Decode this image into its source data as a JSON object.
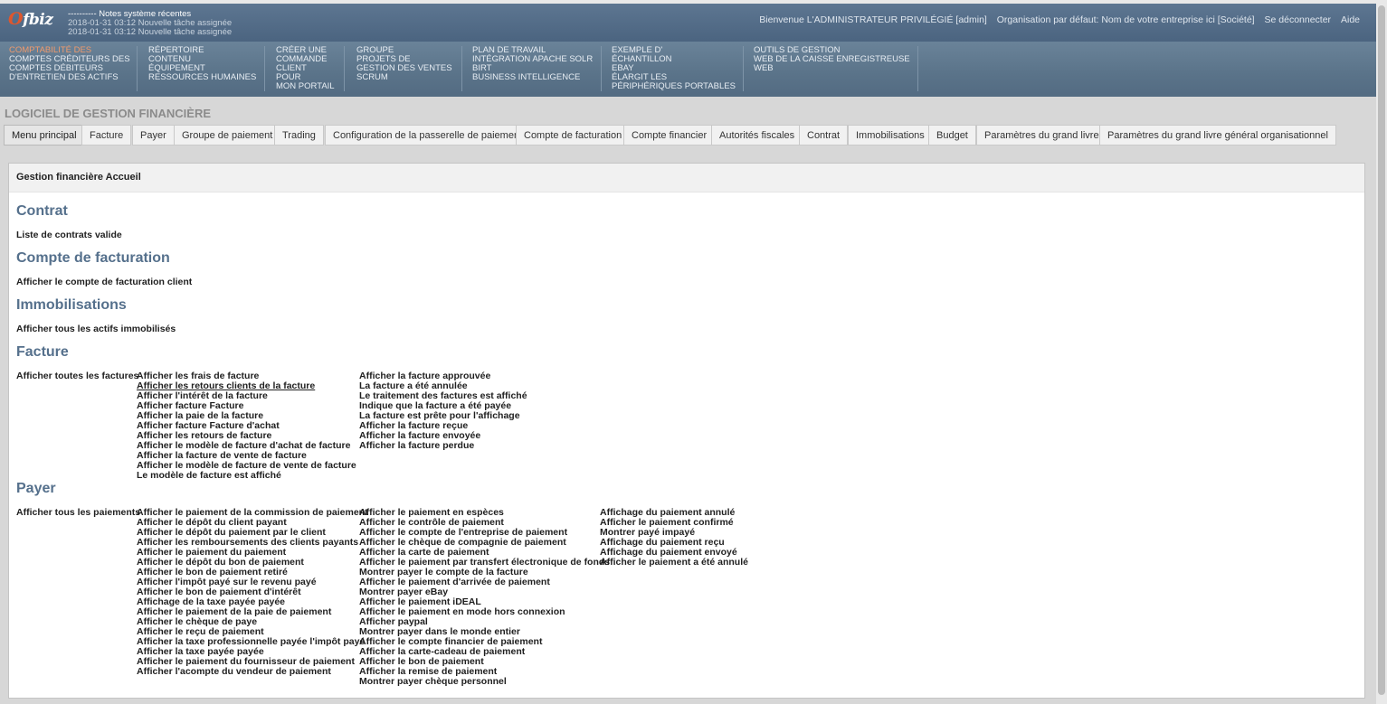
{
  "header": {
    "logo": "ofbiz",
    "notes_title": "---------- Notes système récentes",
    "notes": [
      "2018-01-31 03:12 Nouvelle tâche assignée",
      "2018-01-31 03:12 Nouvelle tâche assignée"
    ],
    "welcome": "Bienvenue L'ADMINISTRATEUR PRIVILÉGIÉ [admin]",
    "organisation": "Organisation par défaut: Nom de votre entreprise ici [Société]",
    "logout": "Se déconnecter",
    "help": "Aide"
  },
  "apps": [
    [
      "Comptabilité des",
      "comptes créditeurs des",
      "comptes débiteurs",
      "d'entretien des actifs"
    ],
    [
      "Répertoire",
      "Contenu",
      "Équipement",
      "Ressources humaines"
    ],
    [
      "Créer une",
      "commande",
      "client",
      "pour",
      "mon portail"
    ],
    [
      "Groupe",
      "projets de",
      "gestion des ventes",
      "Scrum"
    ],
    [
      "Plan de travail",
      "Intégration Apache SOLR",
      "BIRT",
      "Business Intelligence"
    ],
    [
      "Exemple d'",
      "échantillon",
      "eBay",
      "élargit les",
      "périphériques portables"
    ],
    [
      "Outils de gestion",
      "web de la caisse enregistreuse",
      "web"
    ]
  ],
  "app_title": "Logiciel de gestion financière",
  "tabs": [
    "Menu principal",
    "Facture",
    "Payer",
    "Groupe de paiement",
    "Trading",
    "Configuration de la passerelle de paiement",
    "Compte de facturation",
    "Compte financier",
    "Autorités fiscales",
    "Contrat",
    "Immobilisations",
    "Budget",
    "Paramètres du grand livre",
    "Paramètres du grand livre général organisationnel"
  ],
  "panel_title": "Gestion financière Accueil",
  "sections": {
    "contrat": {
      "title": "Contrat",
      "links": [
        "Liste de contrats valide"
      ]
    },
    "compte": {
      "title": "Compte de facturation",
      "links": [
        "Afficher le compte de facturation client"
      ]
    },
    "immo": {
      "title": "Immobilisations",
      "links": [
        "Afficher tous les actifs immobilisés"
      ]
    },
    "facture": {
      "title": "Facture",
      "col1": [
        "Afficher toutes les factures"
      ],
      "col2": [
        "Afficher les frais de facture",
        "Afficher les retours clients de la facture",
        "Afficher l'intérêt de la facture",
        "Afficher facture Facture",
        "Afficher la paie de la facture",
        "Afficher facture Facture d'achat",
        "Afficher les retours de facture",
        "Afficher le modèle de facture d'achat de facture",
        "Afficher la facture de vente de facture",
        "Afficher le modèle de facture de vente de facture",
        "Le modèle de facture est affiché"
      ],
      "col3": [
        "Afficher la facture approuvée",
        "La facture a été annulée",
        "Le traitement des factures est affiché",
        "Indique que la facture a été payée",
        "La facture est prête pour l'affichage",
        "Afficher la facture reçue",
        "Afficher la facture envoyée",
        "Afficher la facture perdue"
      ]
    },
    "payer": {
      "title": "Payer",
      "col1": [
        "Afficher tous les paiements"
      ],
      "col2": [
        "Afficher le paiement de la commission de paiement",
        "Afficher le dépôt du client payant",
        "Afficher le dépôt du paiement par le client",
        "Afficher les remboursements des clients payants",
        "Afficher le paiement du paiement",
        "Afficher le dépôt du bon de paiement",
        "Afficher le bon de paiement retiré",
        "Afficher l'impôt payé sur le revenu payé",
        "Afficher le bon de paiement d'intérêt",
        "Affichage de la taxe payée payée",
        "Afficher le paiement de la paie de paiement",
        "Afficher le chèque de paye",
        "Afficher le reçu de paiement",
        "Afficher la taxe professionnelle payée l'impôt payé",
        "Afficher la taxe payée payée",
        "Afficher le paiement du fournisseur de paiement",
        "Afficher l'acompte du vendeur de paiement"
      ],
      "col3": [
        "Afficher le paiement en espèces",
        "Afficher le contrôle de paiement",
        "Afficher le compte de l'entreprise de paiement",
        "Afficher le chèque de compagnie de paiement",
        "Afficher la carte de paiement",
        "Afficher le paiement par transfert électronique de fonds",
        "Montrer payer le compte de la facture",
        "Afficher le paiement d'arrivée de paiement",
        "Montrer payer eBay",
        "Afficher le paiement iDEAL",
        "Afficher le paiement en mode hors connexion",
        "Afficher paypal",
        "Montrer payer dans le monde entier",
        "Afficher le compte financier de paiement",
        "Afficher la carte-cadeau de paiement",
        "Afficher le bon de paiement",
        "Afficher la remise de paiement",
        "Montrer payer chèque personnel"
      ],
      "col4": [
        "Affichage du paiement annulé",
        "Afficher le paiement confirmé",
        "Montrer payé impayé",
        "Affichage du paiement reçu",
        "Affichage du paiement envoyé",
        "Afficher le paiement a été annulé"
      ]
    }
  }
}
